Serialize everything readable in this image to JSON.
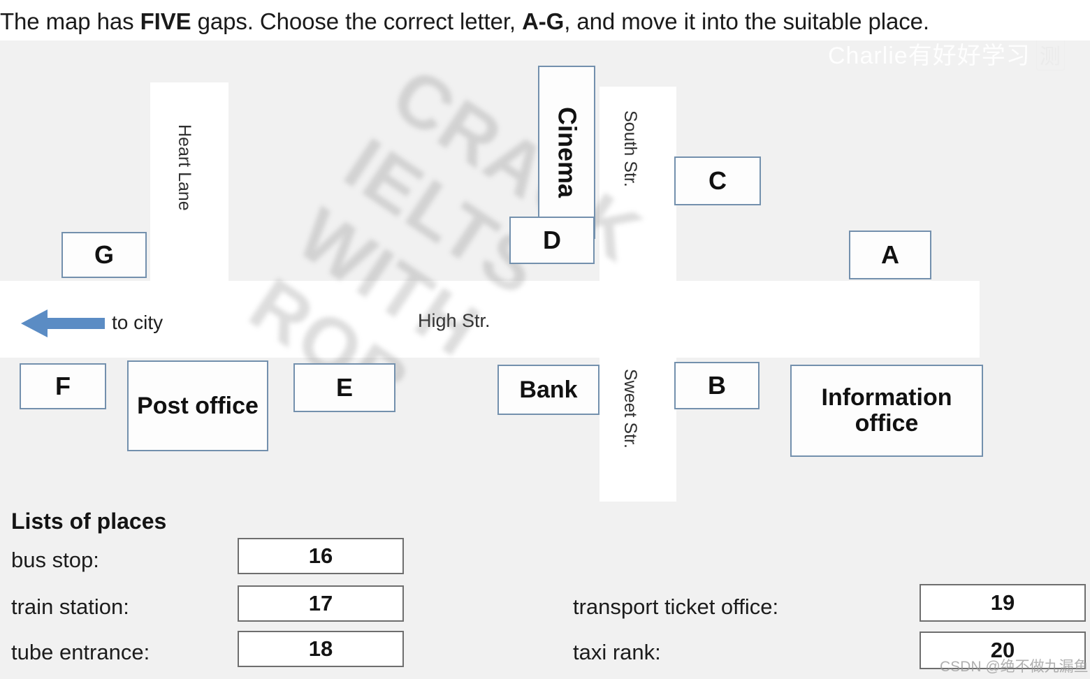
{
  "instruction": {
    "part1": "The map has ",
    "bold1": "FIVE",
    "part2": " gaps. Choose the correct letter, ",
    "bold2": "A-G",
    "part3": ", and move it into the suitable place."
  },
  "watermarks": {
    "crack_line1": "CRACK",
    "crack_line2": "IELTS",
    "crack_line3": "WITH",
    "crack_line4": "ROB",
    "charlie": "Charlie有好好学习",
    "charlie_seal": "测",
    "csdn": "CSDN @绝不做九漏鱼"
  },
  "map": {
    "streets": [
      {
        "name": "Heart Lane"
      },
      {
        "name": "South Str."
      },
      {
        "name": "Sweet Str."
      },
      {
        "name": "High Str."
      }
    ],
    "street_heart_lane": "Heart Lane",
    "street_south": "South Str.",
    "street_sweet": "Sweet Str.",
    "street_high": "High Str.",
    "direction_label": "to city",
    "places": [
      {
        "id": "cinema",
        "label": "Cinema"
      },
      {
        "id": "bank",
        "label": "Bank"
      },
      {
        "id": "post-office",
        "label": "Post office"
      },
      {
        "id": "information-office",
        "label": "Information office"
      }
    ],
    "place_cinema": "Cinema",
    "place_bank": "Bank",
    "place_post_office": "Post office",
    "place_information_office": "Information office",
    "options": [
      {
        "letter": "A"
      },
      {
        "letter": "B"
      },
      {
        "letter": "C"
      },
      {
        "letter": "D"
      },
      {
        "letter": "E"
      },
      {
        "letter": "F"
      },
      {
        "letter": "G"
      }
    ],
    "option_a": "A",
    "option_b": "B",
    "option_c": "C",
    "option_d": "D",
    "option_e": "E",
    "option_f": "F",
    "option_g": "G"
  },
  "lists": {
    "title": "Lists of places",
    "left_column": [
      {
        "label": "bus stop:",
        "value": "16"
      },
      {
        "label": "train station:",
        "value": "17"
      },
      {
        "label": "tube entrance:",
        "value": "18"
      }
    ],
    "right_column": [
      {
        "label": "transport ticket office:",
        "value": "19"
      },
      {
        "label": "taxi rank:",
        "value": "20"
      }
    ],
    "l0_label": "bus stop:",
    "l0_value": "16",
    "l1_label": "train station:",
    "l1_value": "17",
    "l2_label": "tube entrance:",
    "l2_value": "18",
    "r0_label": "transport ticket office:",
    "r0_value": "19",
    "r1_label": "taxi rank:",
    "r1_value": "20"
  },
  "colors": {
    "map_background": "#f1f1f1",
    "road": "#ffffff",
    "box_border": "#7390ad",
    "answer_border": "#6e6e6e",
    "arrow": "#5b8cc4"
  }
}
